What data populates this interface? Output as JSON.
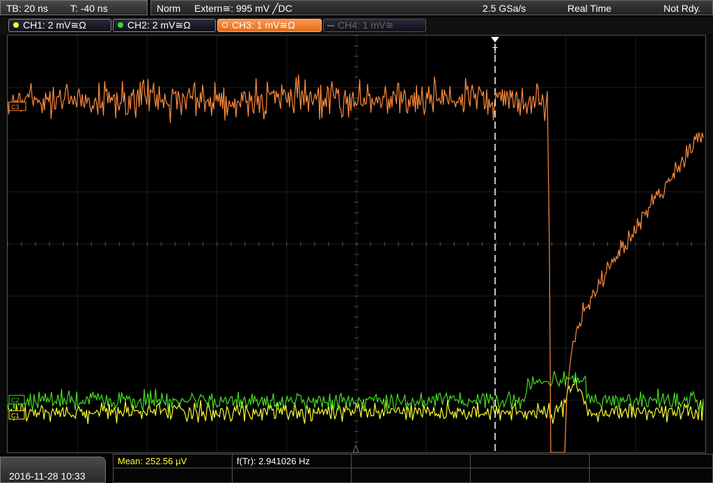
{
  "topbar": {
    "timebase": "TB: 20 ns",
    "trigger_pos": "T: -40 ns",
    "mode": "Norm",
    "trigger_source": "Extern≅: 995 mV ╱DC",
    "sample_rate": "2.5 GSa/s",
    "acq_mode": "Real Time",
    "status": "Not Rdy."
  },
  "channels": [
    {
      "label": "CH1: 2 mV≅Ω",
      "color": "#ffff33"
    },
    {
      "label": "CH2: 2 mV≅Ω",
      "color": "#33dd33"
    },
    {
      "label": "CH3: 1 mV≅Ω",
      "color": "#ff8c3c"
    },
    {
      "label": "CH4: 1 mV≅",
      "color": "#666666"
    }
  ],
  "markers": {
    "trigger": "T",
    "ch3_ref": "C3",
    "ch2_ref": "C2",
    "ch1_ref": "C1"
  },
  "colors": {
    "ch1": "#ffff33",
    "ch2": "#44dd22",
    "ch3": "#ff8c3c",
    "grid": "#3a3a3a"
  },
  "bottom": {
    "datetime": "2016-11-28 10:33",
    "mean": "Mean: 252.56 µV",
    "freq": "f(Tr): 2.941026 Hz"
  }
}
